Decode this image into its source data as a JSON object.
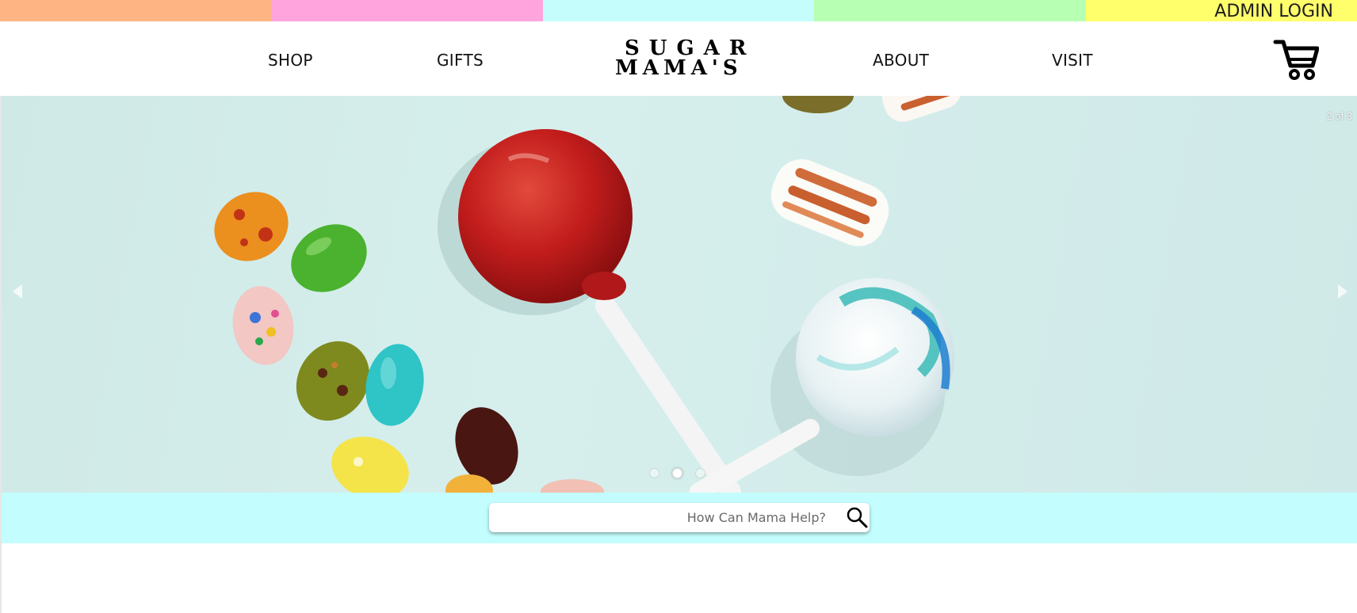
{
  "top_strip": {
    "colors": [
      "#ffb583",
      "#ffa4dd",
      "#c5fdfd",
      "#b6ffb3",
      "#ffff6b"
    ],
    "admin_login": "ADMIN LOGIN"
  },
  "nav": {
    "left_links": [
      "SHOP",
      "GIFTS"
    ],
    "right_links": [
      "ABOUT",
      "VISIT"
    ],
    "logo_line1": "SUGAR",
    "logo_line2": "MAMA'S",
    "cart_icon": "shopping-cart-icon"
  },
  "carousel": {
    "counter": "2 of 3",
    "current_slide": 2,
    "total_slides": 3,
    "prev_icon": "chevron-left-icon",
    "next_icon": "chevron-right-icon"
  },
  "search": {
    "placeholder": "How Can Mama Help?",
    "value": "",
    "icon": "search-icon",
    "band_color": "#c3fdfd"
  }
}
